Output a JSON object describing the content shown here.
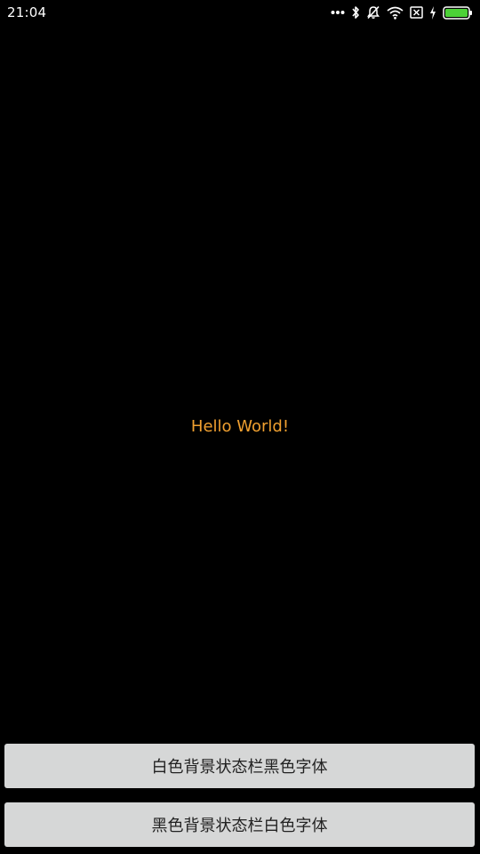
{
  "status_bar": {
    "time": "21:04",
    "icons": [
      "more-dots-icon",
      "bluetooth-icon",
      "mute-icon",
      "wifi-icon",
      "sim-off-icon",
      "charging-icon",
      "battery-icon"
    ],
    "battery_color": "#4cd137"
  },
  "main": {
    "text": "Hello World!",
    "text_color": "#f0a030"
  },
  "buttons": {
    "white_bg_label": "白色背景状态栏黑色字体",
    "black_bg_label": "黑色背景状态栏白色字体"
  }
}
